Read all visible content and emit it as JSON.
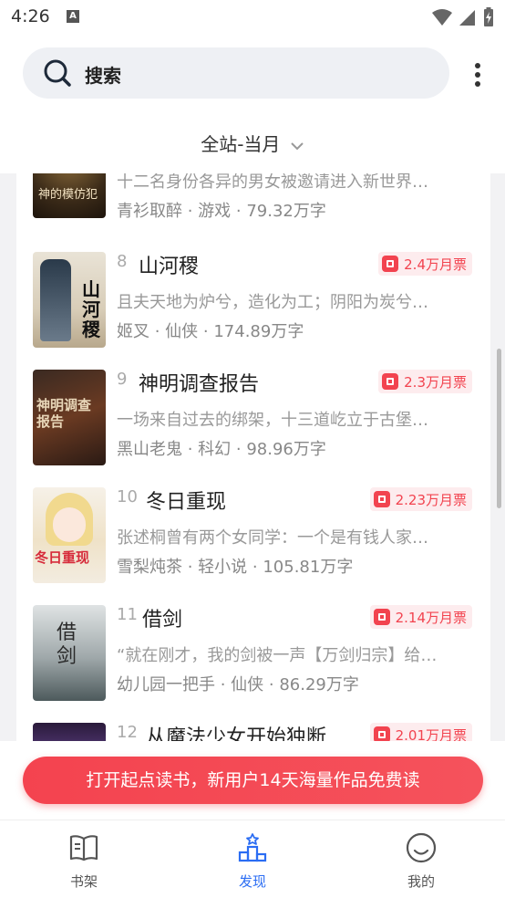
{
  "status_bar": {
    "time": "4:26",
    "notification_letter": "A"
  },
  "search": {
    "placeholder": "搜索"
  },
  "filter": {
    "label": "全站-当月"
  },
  "books": [
    {
      "rank": "",
      "title": "",
      "desc": "十二名身份各异的男女被邀请进入新世界…",
      "author": "青衫取醉",
      "genre": "游戏",
      "words": "79.32万字",
      "cover_text": "神的模仿犯"
    },
    {
      "rank": "8",
      "title": "山河稷",
      "desc": "且夫天地为炉兮，造化为工；阴阳为炭兮…",
      "author": "姬叉",
      "genre": "仙侠",
      "words": "174.89万字",
      "votes": "2.4万月票",
      "cover_text": "山河稷"
    },
    {
      "rank": "9",
      "title": "神明调查报告",
      "desc": "一场来自过去的绑架，十三道屹立于古堡…",
      "author": "黑山老鬼",
      "genre": "科幻",
      "words": "98.96万字",
      "votes": "2.3万月票",
      "cover_text": "神明调查报告"
    },
    {
      "rank": "10",
      "title": "冬日重现",
      "desc": "张述桐曾有两个女同学：一个是有钱人家…",
      "author": "雪梨炖茶",
      "genre": "轻小说",
      "words": "105.81万字",
      "votes": "2.23万月票",
      "cover_text": "冬日重现"
    },
    {
      "rank": "11",
      "title": "借剑",
      "desc": "“就在刚才，我的剑被一声【万剑归宗】给…",
      "author": "幼儿园一把手",
      "genre": "仙侠",
      "words": "86.29万字",
      "votes": "2.14万月票",
      "cover_text": "借剑"
    },
    {
      "rank": "12",
      "title": "从魔法少女开始独断…",
      "desc": "",
      "author": "",
      "genre": "",
      "words": "",
      "votes": "2.01万月票",
      "cover_text": ""
    }
  ],
  "banner": {
    "text": "打开起点读书，新用户14天海量作品免费读"
  },
  "tabs": [
    {
      "label": "书架",
      "icon": "book-icon"
    },
    {
      "label": "发现",
      "icon": "podium-icon"
    },
    {
      "label": "我的",
      "icon": "smiley-icon"
    }
  ],
  "colors": {
    "accent_red": "#f2434f",
    "accent_blue": "#2b6df3"
  }
}
